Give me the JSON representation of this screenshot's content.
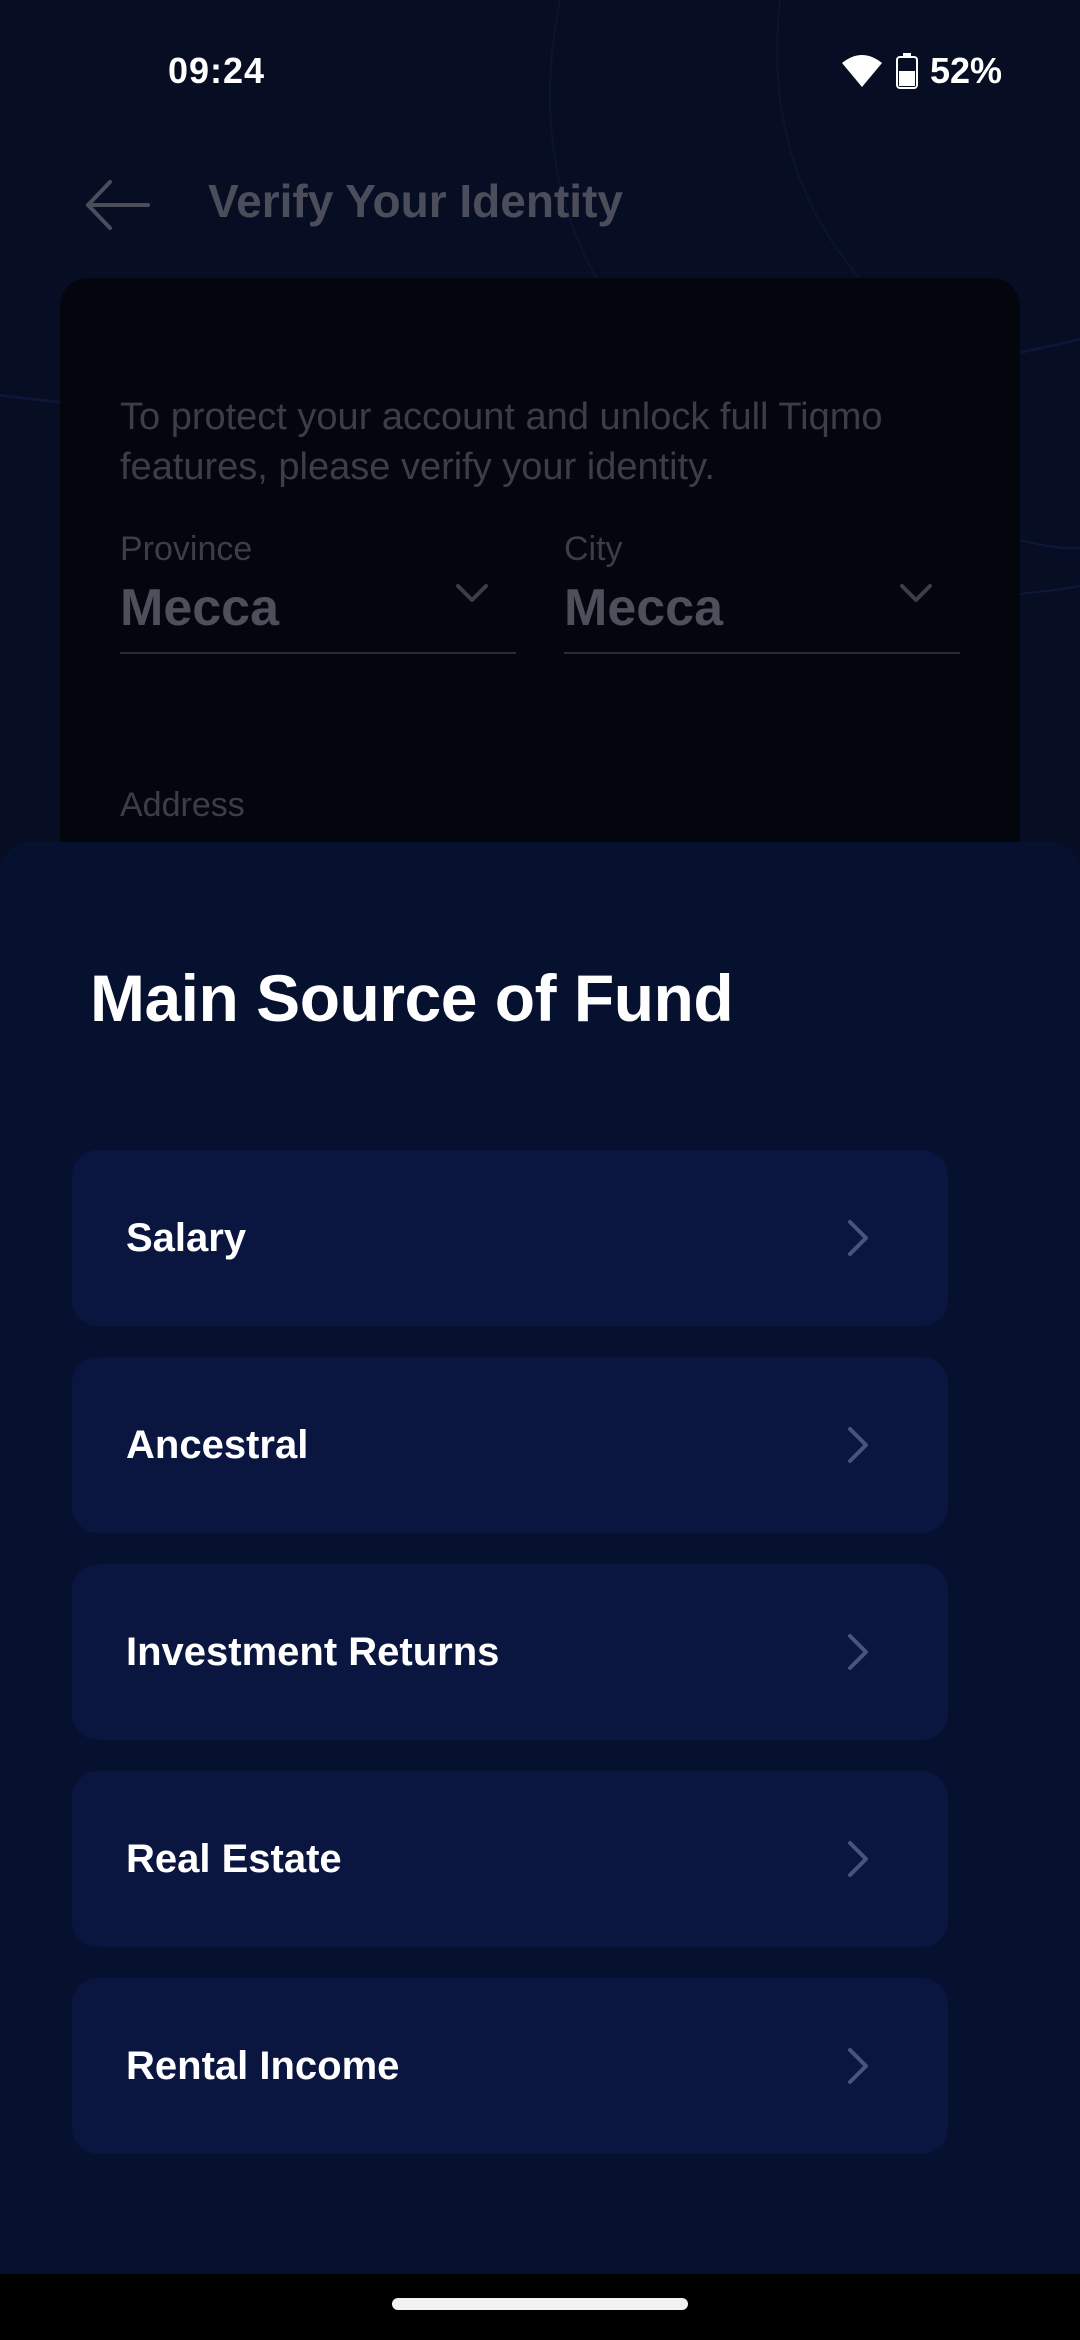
{
  "status_bar": {
    "time": "09:24",
    "battery": "52%",
    "wifi_icon": "wifi-icon",
    "battery_icon": "battery-icon"
  },
  "header": {
    "title": "Verify Your Identity",
    "back_icon": "arrow-left-icon"
  },
  "form": {
    "intro": "To protect your account and unlock full Tiqmo features, please verify your identity.",
    "province_label": "Province",
    "province_value": "Mecca",
    "city_label": "City",
    "city_value": "Mecca",
    "address_label": "Address"
  },
  "sheet": {
    "title": "Main Source of Fund",
    "options": [
      {
        "label": "Salary"
      },
      {
        "label": "Ancestral"
      },
      {
        "label": "Investment Returns"
      },
      {
        "label": "Real Estate"
      },
      {
        "label": "Rental Income"
      }
    ]
  },
  "colors": {
    "background": "#070d22",
    "sheet": "#06102f",
    "option": "#0a1540",
    "text_primary": "#ffffff"
  }
}
